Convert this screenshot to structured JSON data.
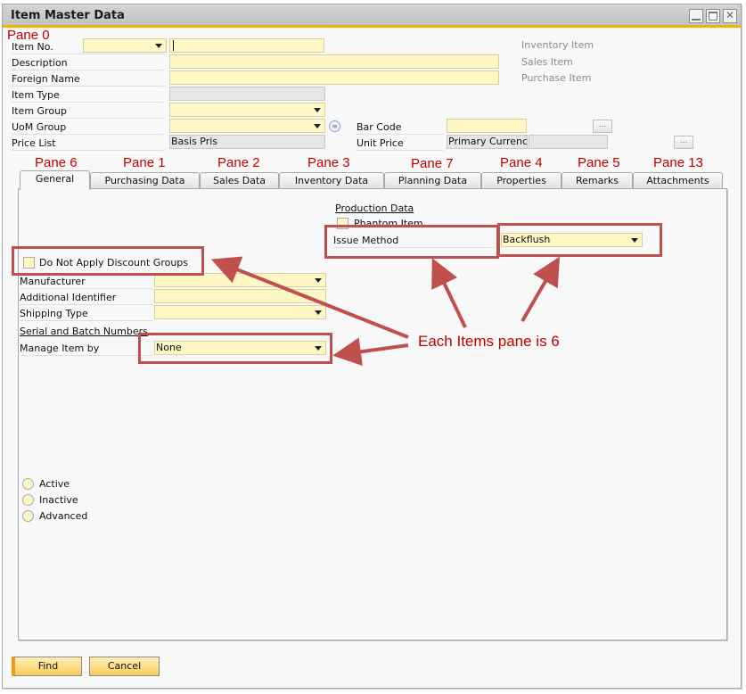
{
  "window": {
    "title": "Item Master Data",
    "controls": [
      "minimize",
      "maximize",
      "close"
    ]
  },
  "header": {
    "item_no_label": "Item No.",
    "item_no_series": "",
    "item_no_value": "",
    "description_label": "Description",
    "description_value": "",
    "foreign_name_label": "Foreign Name",
    "foreign_name_value": "",
    "item_type_label": "Item Type",
    "item_type_value": "",
    "item_group_label": "Item Group",
    "item_group_value": "",
    "uom_group_label": "UoM Group",
    "uom_group_value": "",
    "price_list_label": "Price List",
    "price_list_value": "Basis Pris",
    "bar_code_label": "Bar Code",
    "bar_code_value": "",
    "unit_price_label": "Unit Price",
    "unit_price_currency": "Primary Currenc",
    "unit_price_value": "",
    "inventory_item_label": "Inventory Item",
    "sales_item_label": "Sales Item",
    "purchase_item_label": "Purchase Item",
    "browse_label": "..."
  },
  "tabs": [
    {
      "label": "General",
      "active": true
    },
    {
      "label": "Purchasing Data",
      "active": false
    },
    {
      "label": "Sales Data",
      "active": false
    },
    {
      "label": "Inventory Data",
      "active": false
    },
    {
      "label": "Planning Data",
      "active": false
    },
    {
      "label": "Properties",
      "active": false
    },
    {
      "label": "Remarks",
      "active": false
    },
    {
      "label": "Attachments",
      "active": false
    }
  ],
  "general": {
    "do_not_apply_discount_label": "Do Not Apply Discount Groups",
    "manufacturer_label": "Manufacturer",
    "manufacturer_value": "",
    "additional_identifier_label": "Additional Identifier",
    "additional_identifier_value": "",
    "shipping_type_label": "Shipping Type",
    "shipping_type_value": "",
    "serial_batch_heading": "Serial and Batch Numbers",
    "manage_item_by_label": "Manage Item by",
    "manage_item_by_value": "None",
    "production_heading": "Production Data",
    "phantom_item_label": "Phantom Item",
    "issue_method_label": "Issue Method",
    "issue_method_value": "Backflush",
    "status_options": [
      "Active",
      "Inactive",
      "Advanced"
    ]
  },
  "footer": {
    "find_label": "Find",
    "cancel_label": "Cancel"
  },
  "annotations": {
    "pane0": "Pane 0",
    "tab_panes": [
      "Pane 6",
      "Pane 1",
      "Pane 2",
      "Pane 3",
      "Pane 7",
      "Pane 4",
      "Pane 5",
      "Pane 13"
    ],
    "callout": "Each Items pane is 6",
    "color": "#c0504d"
  },
  "colors": {
    "field_bg": "#fff8c4",
    "title_accent": "#f5b400",
    "button_bg": "#f8cd5a",
    "annotation_red": "#c00000"
  }
}
